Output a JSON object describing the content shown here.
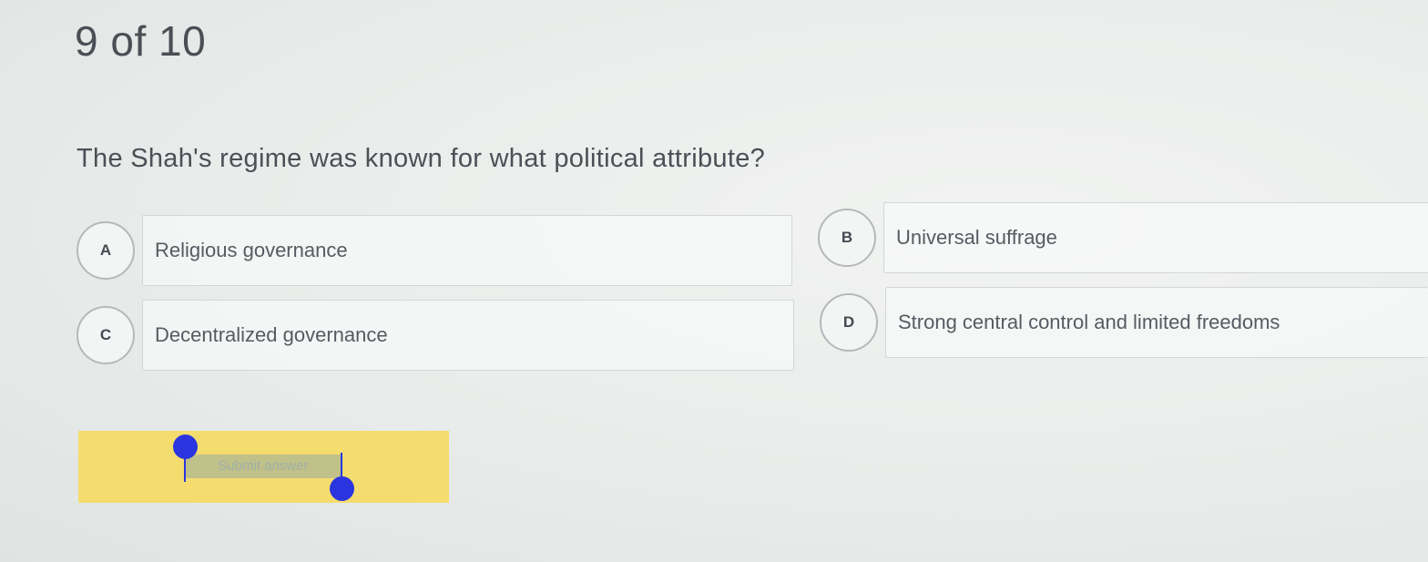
{
  "progress": {
    "counter_text": "9 of 10"
  },
  "question": {
    "text": "The Shah's regime was known for what political attribute?"
  },
  "options": [
    {
      "letter": "A",
      "text": "Religious governance"
    },
    {
      "letter": "B",
      "text": "Universal suffrage"
    },
    {
      "letter": "C",
      "text": "Decentralized governance"
    },
    {
      "letter": "D",
      "text": "Strong central control and limited freedoms"
    }
  ],
  "submit": {
    "label": "Submit answer",
    "background_color": "#f4dc6e",
    "selection_handle_color": "#2a35e0"
  }
}
